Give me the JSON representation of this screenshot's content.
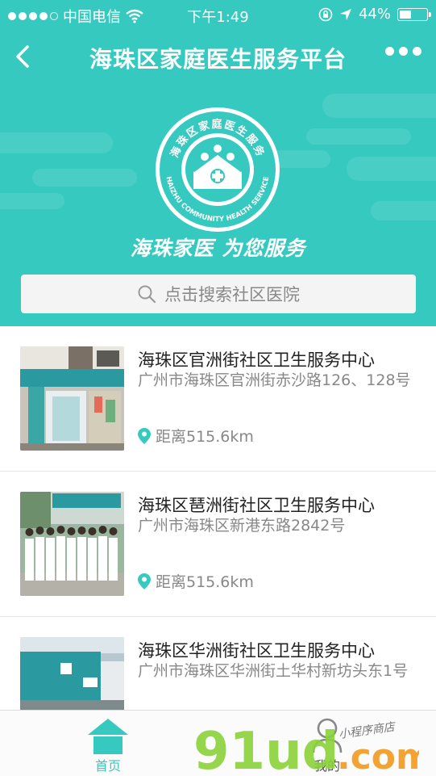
{
  "status_bar": {
    "carrier": "中国电信",
    "time": "下午1:49",
    "battery": "44%",
    "battery_level": 0.44
  },
  "nav": {
    "title": "海珠区家庭医生服务平台"
  },
  "banner": {
    "logo_text_cn": "海珠区家庭医生服务",
    "logo_text_en": "HAIZHU COMMUNITY HEALTH SERVICE",
    "slogan": "海珠家医 为您服务"
  },
  "search": {
    "placeholder": "点击搜索社区医院"
  },
  "hospitals": [
    {
      "name": "海珠区官洲街社区卫生服务中心",
      "address": "广州市海珠区官洲街赤沙路126、128号",
      "distance": "距离515.6km"
    },
    {
      "name": "海珠区琶洲街社区卫生服务中心",
      "address": "广州市海珠区新港东路2842号",
      "distance": "距离515.6km"
    },
    {
      "name": "海珠区华洲街社区卫生服务中心",
      "address": "广州市海珠区华洲街土华村新坊头东1号",
      "distance": ""
    }
  ],
  "tabs": [
    {
      "label": "首页"
    },
    {
      "label": "我的"
    }
  ],
  "watermark": {
    "text": "91ud.com",
    "subtext": "小程序商店"
  },
  "colors": {
    "primary": "#35c9c0",
    "text": "#222222",
    "muted": "#888888"
  }
}
